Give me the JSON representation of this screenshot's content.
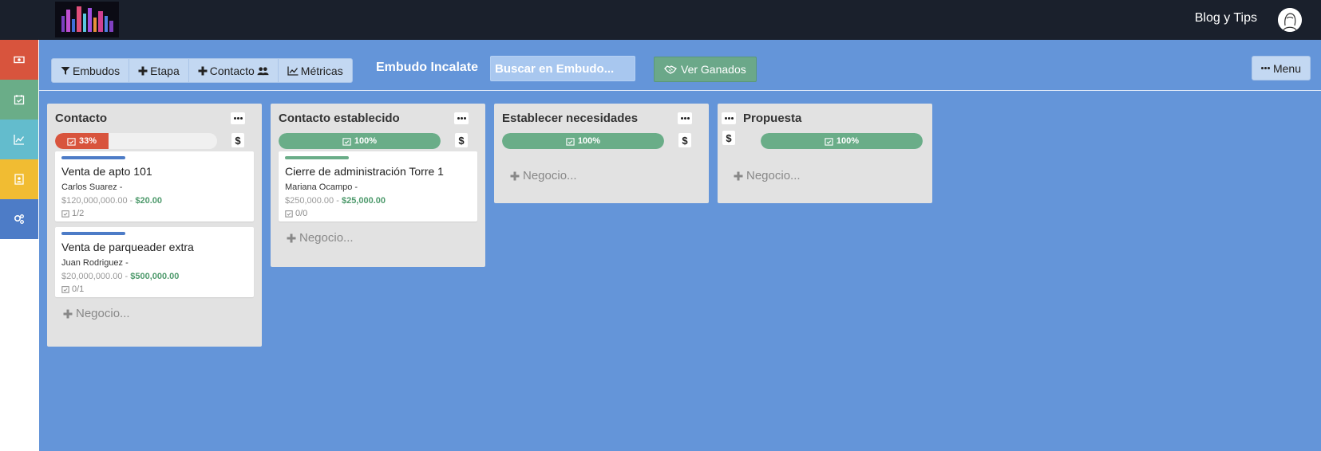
{
  "header": {
    "blog_link": "Blog y Tips"
  },
  "sidebar": {
    "items": [
      {
        "icon": "money-icon",
        "color": "#d8543d"
      },
      {
        "icon": "calendar-check-icon",
        "color": "#6aad88"
      },
      {
        "icon": "chart-line-icon",
        "color": "#63bccd"
      },
      {
        "icon": "contact-card-icon",
        "color": "#f1bc32"
      },
      {
        "icon": "cogs-icon",
        "color": "#4d7cc7"
      }
    ]
  },
  "toolbar": {
    "funnels_label": "Embudos",
    "stage_label": "Etapa",
    "contact_label": "Contacto",
    "metrics_label": "Métricas",
    "funnel_name": "Embudo Incalate",
    "search_placeholder": "Buscar en Embudo...",
    "won_label": "Ver Ganados",
    "menu_label": "Menu"
  },
  "columns": [
    {
      "title": "Contacto",
      "progress_label": "33%",
      "progress_value": 0.33,
      "progress_color": "#d8543d",
      "dollar": "$",
      "deals": [
        {
          "title": "Venta de apto 101",
          "person": "Carlos Suarez -",
          "amount": "$120,000,000.00",
          "separator": " - ",
          "value": "$20.00",
          "tasks": "1/2",
          "bar_color": "#4d7cc7"
        },
        {
          "title": "Venta de parqueader extra",
          "person": "Juan Rodriguez -",
          "amount": "$20,000,000.00",
          "separator": " - ",
          "value": "$500,000.00",
          "tasks": "0/1",
          "bar_color": "#4d7cc7"
        }
      ],
      "add_label": "Negocio..."
    },
    {
      "title": "Contacto establecido",
      "progress_label": "100%",
      "progress_value": 1.0,
      "progress_color": "#6aad88",
      "dollar": "$",
      "deals": [
        {
          "title": "Cierre de administración Torre 1",
          "person": "Mariana Ocampo -",
          "amount": "$250,000.00",
          "separator": " - ",
          "value": "$25,000.00",
          "tasks": "0/0",
          "bar_color": "#6aad88"
        }
      ],
      "add_label": "Negocio..."
    },
    {
      "title": "Establecer necesidades",
      "progress_label": "100%",
      "progress_value": 1.0,
      "progress_color": "#6aad88",
      "dollar": "$",
      "deals": [],
      "add_label": "Negocio..."
    },
    {
      "title": "Propuesta",
      "progress_label": "100%",
      "progress_value": 1.0,
      "progress_color": "#6aad88",
      "dollar": "$",
      "deals": [],
      "add_label": "Negocio..."
    }
  ]
}
